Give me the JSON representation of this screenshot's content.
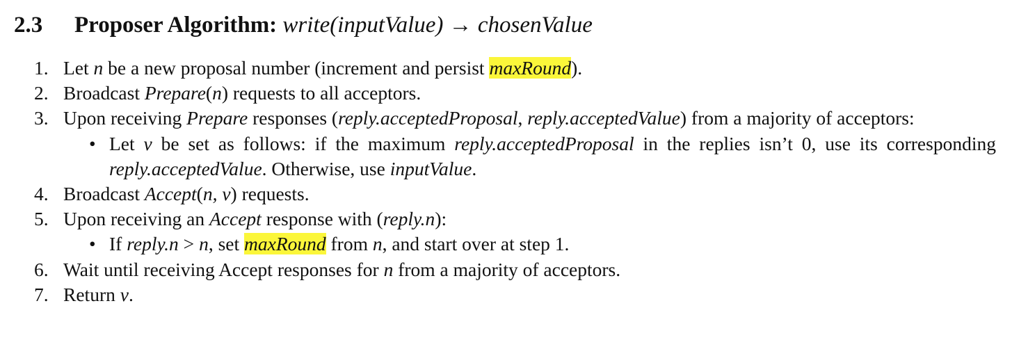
{
  "section": {
    "number": "2.3",
    "label": "Proposer Algorithm:",
    "signature": "write(inputValue) → chosenValue"
  },
  "highlight_color": "#fbf63a",
  "steps": [
    {
      "number": "1.",
      "segments": [
        {
          "t": "Let "
        },
        {
          "t": "n",
          "i": true
        },
        {
          "t": " be a new proposal number (increment and persist "
        },
        {
          "t": "maxRound",
          "i": true,
          "hl": true
        },
        {
          "t": ")."
        }
      ]
    },
    {
      "number": "2.",
      "segments": [
        {
          "t": "Broadcast "
        },
        {
          "t": "Prepare",
          "i": true
        },
        {
          "t": "("
        },
        {
          "t": "n",
          "i": true
        },
        {
          "t": ") requests to all acceptors."
        }
      ]
    },
    {
      "number": "3.",
      "segments": [
        {
          "t": "Upon receiving "
        },
        {
          "t": "Prepare",
          "i": true
        },
        {
          "t": " responses ("
        },
        {
          "t": "reply.acceptedProposal",
          "i": true
        },
        {
          "t": ", "
        },
        {
          "t": "reply.acceptedValue",
          "i": true
        },
        {
          "t": ") from a majority of acceptors:"
        }
      ],
      "bullets": [
        [
          {
            "t": "Let "
          },
          {
            "t": "v",
            "i": true
          },
          {
            "t": " be set as follows: if the maximum "
          },
          {
            "t": "reply.acceptedProposal",
            "i": true
          },
          {
            "t": " in the replies isn’t 0, use its corresponding "
          },
          {
            "t": "reply.acceptedValue",
            "i": true
          },
          {
            "t": ". Otherwise, use "
          },
          {
            "t": "inputValue",
            "i": true
          },
          {
            "t": "."
          }
        ]
      ]
    },
    {
      "number": "4.",
      "segments": [
        {
          "t": "Broadcast "
        },
        {
          "t": "Accept",
          "i": true
        },
        {
          "t": "("
        },
        {
          "t": "n, v",
          "i": true
        },
        {
          "t": ") requests."
        }
      ]
    },
    {
      "number": "5.",
      "segments": [
        {
          "t": "Upon receiving an "
        },
        {
          "t": "Accept",
          "i": true
        },
        {
          "t": " response with ("
        },
        {
          "t": "reply.n",
          "i": true
        },
        {
          "t": "):"
        }
      ],
      "bullets": [
        [
          {
            "t": "If "
          },
          {
            "t": "reply.n",
            "i": true
          },
          {
            "t": " > "
          },
          {
            "t": "n",
            "i": true
          },
          {
            "t": ", set "
          },
          {
            "t": "maxRound",
            "i": true,
            "hl": true
          },
          {
            "t": " from "
          },
          {
            "t": "n",
            "i": true
          },
          {
            "t": ", and start over at step 1."
          }
        ]
      ]
    },
    {
      "number": "6.",
      "segments": [
        {
          "t": "Wait until receiving Accept responses for "
        },
        {
          "t": "n",
          "i": true
        },
        {
          "t": " from a majority of acceptors."
        }
      ]
    },
    {
      "number": "7.",
      "segments": [
        {
          "t": "Return "
        },
        {
          "t": "v",
          "i": true
        },
        {
          "t": "."
        }
      ]
    }
  ]
}
